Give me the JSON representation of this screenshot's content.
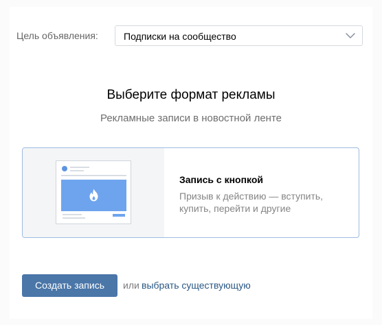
{
  "goal": {
    "label": "Цель объявления:",
    "selected": "Подписки на сообщество",
    "chevron_icon": "chevron-down-icon"
  },
  "format": {
    "title": "Выберите формат рекламы",
    "subtitle": "Рекламные записи в новостной ленте",
    "card": {
      "title": "Запись с кнопкой",
      "description": "Призыв к действию — вступить, купить, перейти и другие",
      "preview_icon": "fire-icon"
    }
  },
  "actions": {
    "create_label": "Создать запись",
    "or_text": "или",
    "existing_link": "выбрать существующую"
  },
  "colors": {
    "accent": "#4a76a8",
    "link": "#2a5885",
    "card_border": "#9dbbe0",
    "preview_blue": "#6ea4ee"
  }
}
